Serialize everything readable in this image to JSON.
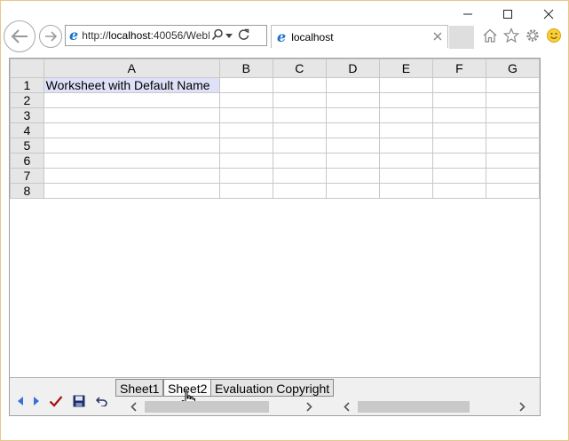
{
  "browser": {
    "address": {
      "url_prefix": "http://",
      "url_host": "localhost",
      "url_rest": ":40056/WebF"
    },
    "tab": {
      "title": "localhost"
    }
  },
  "spreadsheet": {
    "columns": [
      "A",
      "B",
      "C",
      "D",
      "E",
      "F",
      "G"
    ],
    "rows": [
      "1",
      "2",
      "3",
      "4",
      "5",
      "6",
      "7",
      "8"
    ],
    "cells": {
      "A1": "Worksheet with Default Name"
    },
    "sheet_tabs": [
      "Sheet1",
      "Sheet2",
      "Evaluation Copyright"
    ],
    "active_sheet": "Sheet2"
  },
  "icons": {
    "back": "back-arrow-icon",
    "forward": "forward-arrow-icon",
    "search": "search-icon",
    "refresh": "refresh-icon",
    "home": "home-icon",
    "favorites": "star-icon",
    "settings": "gear-icon",
    "feedback": "smiley-icon"
  },
  "colors": {
    "selected_cell": "#dfe1f8",
    "header_bg": "#e6e6e6",
    "window_border": "#e8c88b"
  }
}
